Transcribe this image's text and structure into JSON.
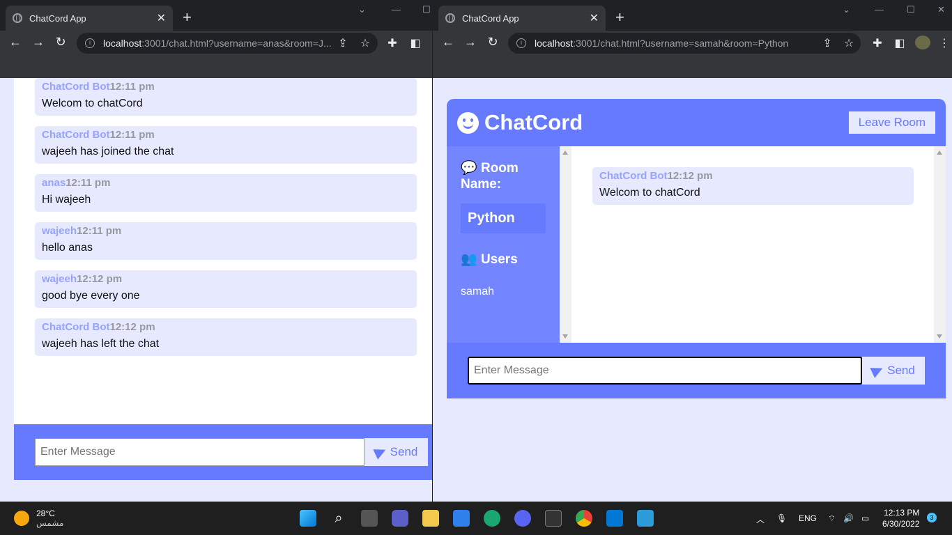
{
  "left_window": {
    "tab_title": "ChatCord App",
    "url_host": "localhost",
    "url_rest": ":3001/chat.html?username=anas&room=J...",
    "messages": [
      {
        "user": "ChatCord Bot",
        "time": "12:11 pm",
        "text": "Welcom to chatCord"
      },
      {
        "user": "ChatCord Bot",
        "time": "12:11 pm",
        "text": "wajeeh has joined the chat"
      },
      {
        "user": "anas",
        "time": "12:11 pm",
        "text": "Hi wajeeh"
      },
      {
        "user": "wajeeh",
        "time": "12:11 pm",
        "text": "hello anas"
      },
      {
        "user": "wajeeh",
        "time": "12:12 pm",
        "text": "good bye every one"
      },
      {
        "user": "ChatCord Bot",
        "time": "12:12 pm",
        "text": "wajeeh has left the chat"
      }
    ],
    "input_placeholder": "Enter Message",
    "send_label": "Send"
  },
  "right_window": {
    "tab_title": "ChatCord App",
    "url_host": "localhost",
    "url_rest": ":3001/chat.html?username=samah&room=Python",
    "app_title": "ChatCord",
    "leave_label": "Leave Room",
    "room_heading": "Room Name:",
    "room_name": "Python",
    "users_heading": "Users",
    "users": [
      "samah"
    ],
    "messages": [
      {
        "user": "ChatCord Bot",
        "time": "12:12 pm",
        "text": "Welcom to chatCord"
      }
    ],
    "input_placeholder": "Enter Message",
    "send_label": "Send"
  },
  "taskbar": {
    "weather_temp": "28°C",
    "weather_desc": "مشمس",
    "language": "ENG",
    "time": "12:13 PM",
    "date": "6/30/2022",
    "notifications": "3"
  },
  "colors": {
    "accent": "#667aff",
    "light": "#e6e9ff",
    "sidebar": "#7386ff"
  }
}
